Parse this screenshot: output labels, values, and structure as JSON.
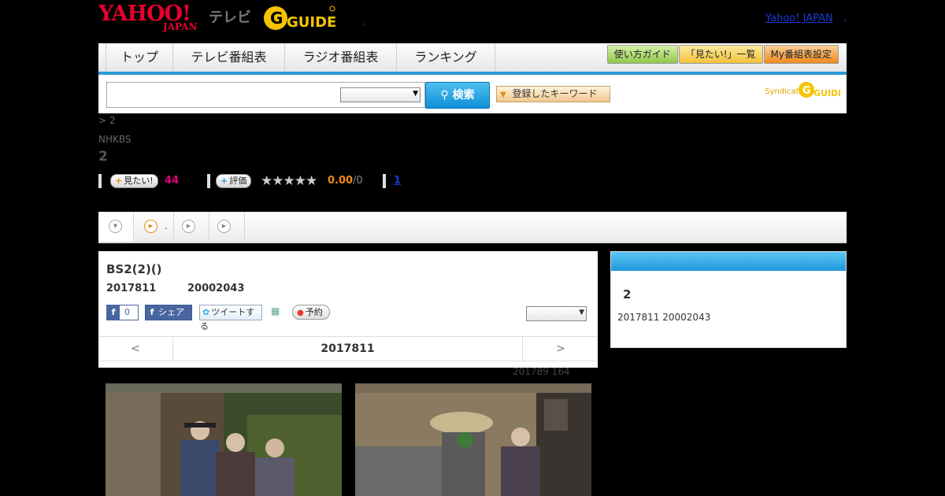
{
  "header": {
    "logo_yahoo": "YAHOO!",
    "logo_japan": "JAPAN",
    "logo_tv": "テレビ",
    "logo_gguide_text": "GUIDE",
    "separator_dot": ",",
    "yahoo_japan_link": "Yahoo! JAPAN",
    "trailing_dot": "."
  },
  "nav": {
    "tabs": [
      {
        "label": "トップ"
      },
      {
        "label": "テレビ番組表"
      },
      {
        "label": "ラジオ番組表"
      },
      {
        "label": "ランキング"
      }
    ],
    "buttons": [
      {
        "label": "使い方ガイド",
        "color": "#a8d86a"
      },
      {
        "label": "「見たい!」一覧",
        "color": "#f9d35a"
      },
      {
        "label": "My番組表設定",
        "color": "#f7a23a"
      }
    ]
  },
  "search": {
    "query": "",
    "select_value": "",
    "button_label": "検索",
    "keyword_button_label": "登録したキーワード",
    "syndicated_label": "Syndicated"
  },
  "program": {
    "breadcrumb": "> 2",
    "channel": "NHKBS",
    "title": "2",
    "want_label": "見たい!",
    "want_count": "44",
    "rate_label": "評価",
    "stars": "★★★★★",
    "rating_value": "0.00",
    "rating_count": "/0",
    "extra_link": "1"
  },
  "tabs": {
    "tab2_text": "."
  },
  "info": {
    "title": "BS2(2)()",
    "date": "2017811",
    "time": "20002043",
    "fb_like_count": "0",
    "fb_share_label": "シェア",
    "tweet_label": "ツイートする",
    "reserve_label": "予約",
    "select_value": "",
    "prev_label": "<",
    "current_date": "2017811",
    "next_label": ">",
    "sub_date": "201789  164"
  },
  "sidebar": {
    "title": "2",
    "date_time": "2017811  20002043"
  },
  "colors": {
    "accent_blue": "#2a9ad8",
    "brand_red": "#e6002d",
    "want_pink": "#e6007a",
    "rating_orange": "#f08a1a"
  }
}
